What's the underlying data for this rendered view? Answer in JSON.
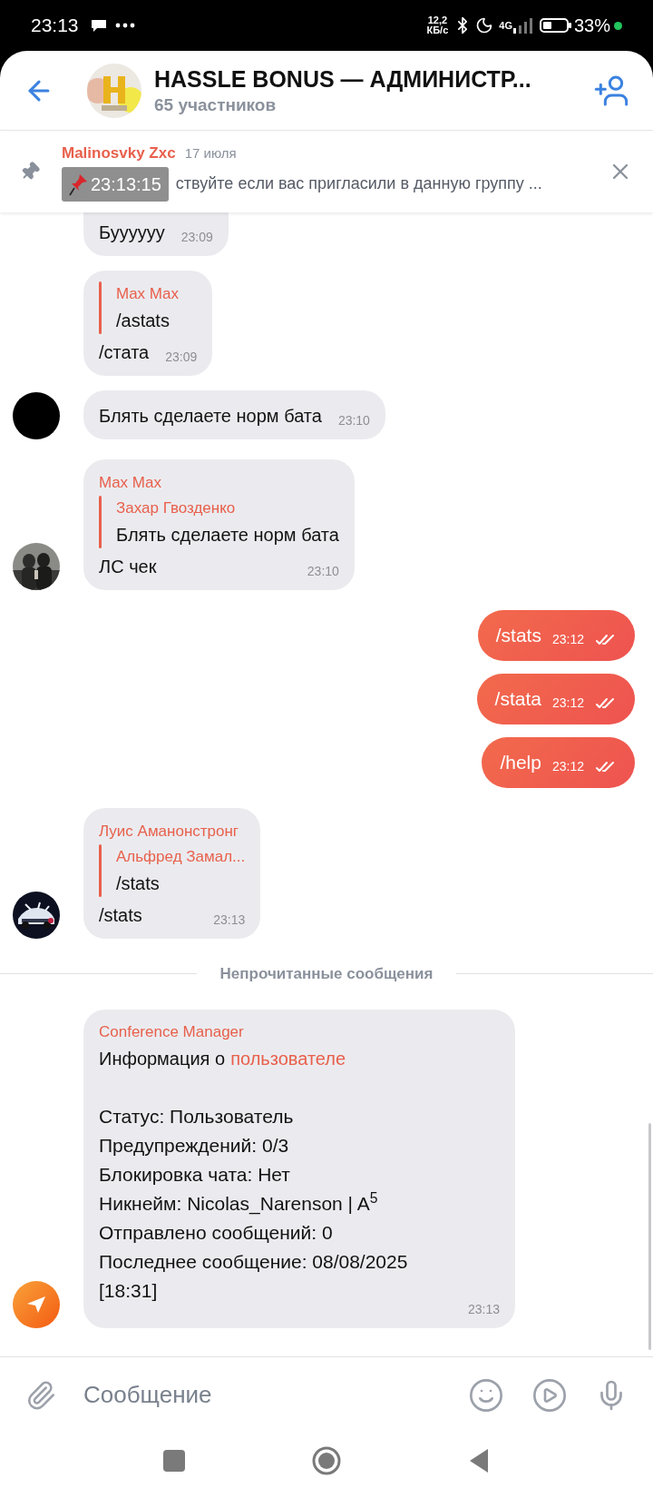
{
  "status_bar": {
    "time": "23:13",
    "speed_value": "12,2",
    "speed_unit": "КБ/с",
    "network": "4G",
    "battery": "33%"
  },
  "header": {
    "title": "HASSLE BONUS — АДМИНИСТР...",
    "subtitle": "65 участников"
  },
  "pinned": {
    "author": "Malinosvky Zxc",
    "date": "17 июля",
    "text": "ствуйте если вас пригласили в данную группу ..."
  },
  "overlay": {
    "time": "23:13:15"
  },
  "messages": [
    {
      "kind": "incoming",
      "text": "Буууууу",
      "time": "23:09",
      "cut_top": true
    },
    {
      "kind": "incoming",
      "reply": {
        "author": "Max Max",
        "text": "/astats"
      },
      "text": "/стата",
      "time": "23:09"
    },
    {
      "kind": "incoming",
      "avatar": {
        "kind": "black"
      },
      "text": "Блять сделаете норм бата",
      "time": "23:10"
    },
    {
      "kind": "incoming",
      "sender": "Max Max",
      "reply": {
        "author": "Захар Гвозденко",
        "text": "Блять сделаете норм бата"
      },
      "text": "ЛС чек",
      "time": "23:10"
    },
    {
      "kind": "outgoing",
      "text": "/stats",
      "time": "23:12",
      "read": true
    },
    {
      "kind": "outgoing",
      "text": "/stata",
      "time": "23:12",
      "read": true
    },
    {
      "kind": "outgoing",
      "text": "/help",
      "time": "23:12",
      "read": true
    },
    {
      "kind": "incoming",
      "avatar": {
        "kind": "car"
      },
      "sender": "Луис Аманонстронг",
      "reply": {
        "author": "Альфред Замал...",
        "text": "/stats"
      },
      "text": "/stats",
      "time": "23:13"
    },
    {
      "kind": "divider",
      "text": "Непрочитанные сообщения"
    },
    {
      "kind": "info",
      "avatar": {
        "kind": "bot"
      },
      "sender": "Conference Manager",
      "heading": "Информация о",
      "heading_link": "пользователе",
      "lines": [
        "Статус: Пользователь",
        "Предупреждений: 0/3",
        "Блокировка чата: Нет",
        "Никнейм: Nicolas_Narenson | A$^{5}$",
        "Отправлено сообщений: 0",
        "Последнее сообщение: 08/08/2025 [18:31]"
      ],
      "time": "23:13"
    }
  ],
  "composer": {
    "placeholder": "Сообщение"
  }
}
